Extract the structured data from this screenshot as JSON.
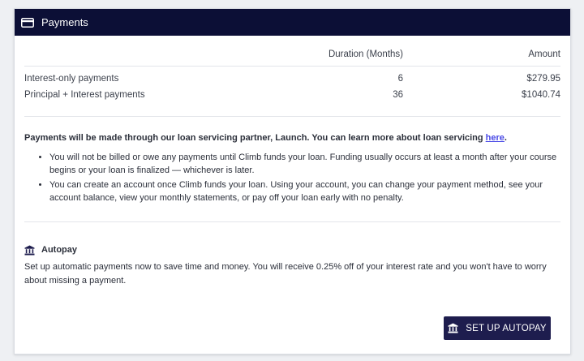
{
  "header": {
    "title": "Payments",
    "icon": "credit-card-icon"
  },
  "table": {
    "columns": [
      "",
      "Duration (Months)",
      "Amount"
    ],
    "rows": [
      {
        "name": "Interest-only payments",
        "duration": "6",
        "amount": "$279.95"
      },
      {
        "name": "Principal + Interest payments",
        "duration": "36",
        "amount": "$1040.74"
      }
    ]
  },
  "info": {
    "lead": "Payments will be made through our loan servicing partner, Launch. You can learn more about loan servicing ",
    "link": "here",
    "lead_end": ".",
    "bullets": [
      "You will not be billed or owe any payments until Climb funds your loan. Funding usually occurs at least a month after your course begins or your loan is finalized — whichever is later.",
      "You can create an account once Climb funds your loan. Using your account, you can change your payment method, see your account balance, view your monthly statements, or pay off your loan early with no penalty."
    ]
  },
  "autopay": {
    "title": "Autopay",
    "icon": "bank-icon",
    "description": "Set up automatic payments now to save time and money. You will receive 0.25% off of your interest rate and you won't have to worry about missing a payment.",
    "button_label": "SET UP AUTOPAY"
  },
  "colors": {
    "header_bg": "#0c0f36",
    "button_bg": "#1e1d4e",
    "link": "#4a4ae6"
  }
}
